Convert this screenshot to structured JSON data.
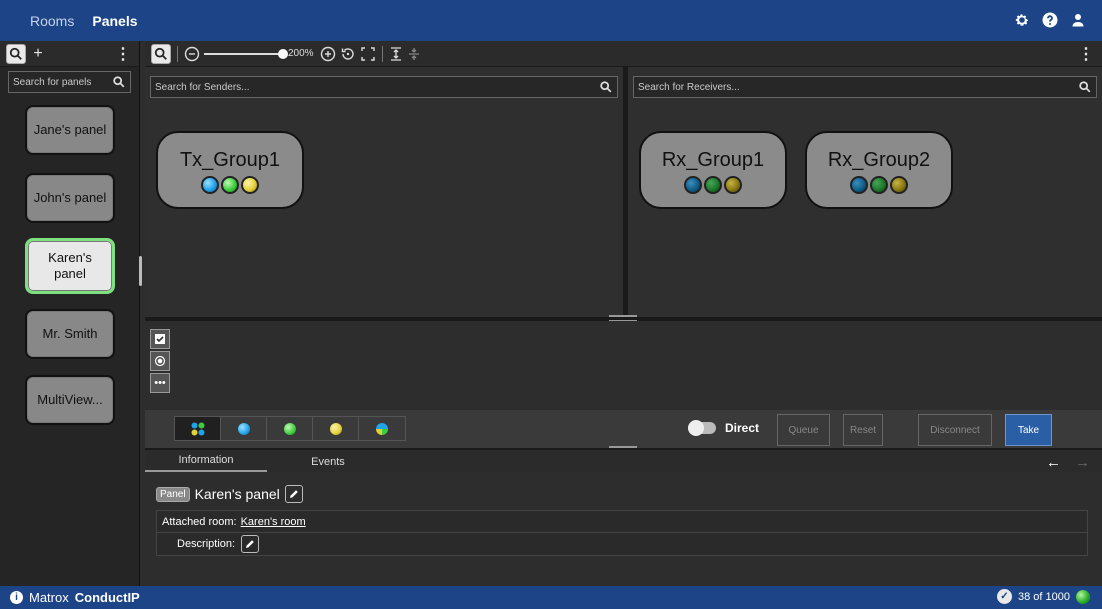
{
  "nav": {
    "tabs": [
      {
        "label": "Rooms",
        "active": false
      },
      {
        "label": "Panels",
        "active": true
      }
    ],
    "icons": [
      "gear-icon",
      "help-icon",
      "user-icon"
    ]
  },
  "sidebar": {
    "search_placeholder": "Search for panels",
    "panels": [
      {
        "label": "Jane's panel",
        "selected": false
      },
      {
        "label": "John's panel",
        "selected": false
      },
      {
        "label": "Karen's panel",
        "selected": true
      },
      {
        "label": "Mr. Smith",
        "selected": false
      },
      {
        "label": "MultiView...",
        "selected": false
      }
    ]
  },
  "toolbar": {
    "zoom_label": "200%"
  },
  "senders": {
    "search_placeholder": "Search for Senders...",
    "groups": [
      {
        "title": "Tx_Group1",
        "leds": [
          "#1fa3ea",
          "#3ccf3c",
          "#e2d13a"
        ]
      }
    ]
  },
  "receivers": {
    "search_placeholder": "Search for Receivers...",
    "groups": [
      {
        "title": "Rx_Group1",
        "leds": [
          "#0f5f8a",
          "#1c7a2a",
          "#8a7a12"
        ]
      },
      {
        "title": "Rx_Group2",
        "leds": [
          "#0f5f8a",
          "#1c7a2a",
          "#8a7a12"
        ]
      }
    ]
  },
  "actions": {
    "direct_label": "Direct",
    "queue": "Queue",
    "reset": "Reset",
    "disconnect": "Disconnect",
    "take": "Take"
  },
  "info": {
    "tabs": [
      "Information",
      "Events"
    ],
    "badge": "Panel",
    "title": "Karen's panel",
    "attached_room_label": "Attached room:",
    "attached_room_value": "Karen's room",
    "description_label": "Description:"
  },
  "footer": {
    "brand_prefix": "Matrox",
    "brand_name": "ConductIP",
    "license": "38 of 1000"
  },
  "colors": {
    "nav_blue": "#1d4486",
    "selected_border": "#7ee07e",
    "take_blue": "#2a5fa5"
  }
}
